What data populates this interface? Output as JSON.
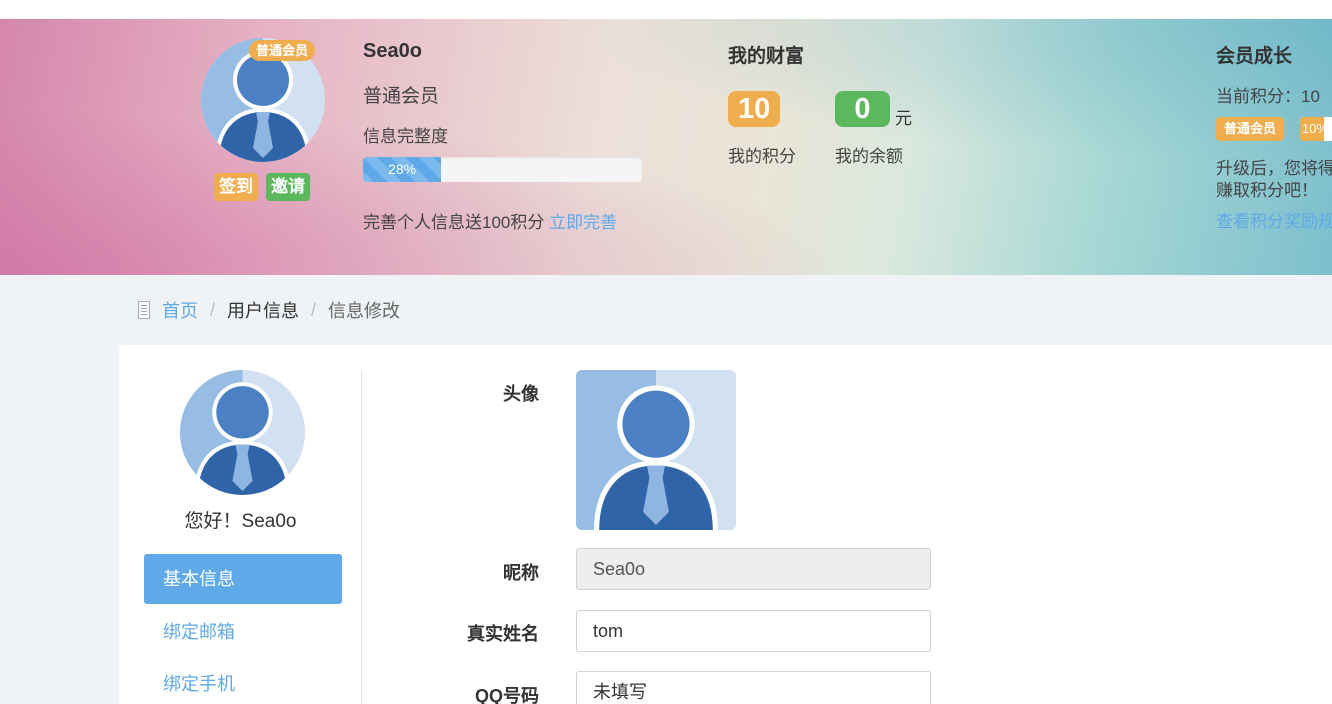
{
  "user": {
    "name": "Sea0o",
    "level": "普通会员",
    "member_badge": "普通会员",
    "sign_label": "签到",
    "invite_label": "邀请",
    "completeness_label": "信息完整度",
    "completeness_percent": 28,
    "completeness_text": "28%",
    "perfect_hint": "完善个人信息送100积分",
    "perfect_link": "立即完善"
  },
  "wealth": {
    "title": "我的财富",
    "points": "10",
    "points_label": "我的积分",
    "balance": "0",
    "balance_unit": "元",
    "balance_label": "我的余额"
  },
  "growth": {
    "title": "会员成长",
    "current": "当前积分：10",
    "level_badge": "普通会员",
    "level_progress_text": "10%",
    "level_progress_percent": 10,
    "desc_line1": "升级后，您将得",
    "desc_line2": "赚取积分吧！",
    "link": "查看积分奖励规"
  },
  "breadcrumb": {
    "home": "首页",
    "sep1": "/",
    "section": "用户信息",
    "sep2": "/",
    "current": "信息修改"
  },
  "sidebar": {
    "greeting": "您好！Sea0o",
    "items": [
      {
        "label": "基本信息",
        "active": true
      },
      {
        "label": "绑定邮箱",
        "active": false
      },
      {
        "label": "绑定手机",
        "active": false
      }
    ]
  },
  "form": {
    "avatar_label": "头像",
    "nickname_label": "昵称",
    "nickname_value": "Sea0o",
    "realname_label": "真实姓名",
    "realname_value": "tom",
    "qq_label": "QQ号码",
    "qq_value": "未填写"
  },
  "colors": {
    "accent": "#5fa9e8",
    "orange": "#f0ad4e",
    "green": "#5cb85c"
  }
}
